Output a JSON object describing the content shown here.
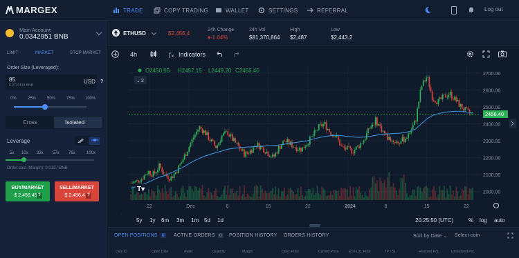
{
  "brand": "MARGEX",
  "nav": [
    {
      "label": "TRADE",
      "icon": "trade-icon",
      "active": true
    },
    {
      "label": "COPY TRADING",
      "icon": "copy-icon",
      "active": false
    },
    {
      "label": "WALLET",
      "icon": "wallet-icon",
      "active": false
    },
    {
      "label": "SETTINGS",
      "icon": "gear-icon",
      "active": false
    },
    {
      "label": "REFERRAL",
      "icon": "referral-icon",
      "active": false
    }
  ],
  "topright": {
    "logout": "Log out"
  },
  "account": {
    "label": "Main Account",
    "balance": "0.0342951 BNB"
  },
  "order_tabs": [
    "LIMIT",
    "MARKET",
    "STOP MARKET"
  ],
  "order_size": {
    "label": "Order Size (Leveraged):",
    "value": "85",
    "sub": "0.2733119 BNB",
    "unit": "USD"
  },
  "size_percents": [
    "0%",
    "25%",
    "50%",
    "75%",
    "100%"
  ],
  "size_slider_fraction": 0.43,
  "margin_modes": [
    "Cross",
    "Isolated"
  ],
  "leverage": {
    "label": "Leverage",
    "options": [
      "5x",
      "10x",
      "33x",
      "57x",
      "76x",
      "100x"
    ],
    "slider_fraction": 0.21
  },
  "order_cost": "Order cost (Margin): 0.0137 BNB",
  "buy": {
    "title": "BUY/MARKET",
    "price": "$ 2,456.45"
  },
  "sell": {
    "title": "SELL/MARKET",
    "price": "$ 2,456.4"
  },
  "ticker": {
    "symbol": "ETHUSD",
    "price": "$2,456.4",
    "change_label": "24h Change",
    "change_value": "-1.04%",
    "vol_label": "24h Vol",
    "vol_value": "$81,370,864",
    "high_label": "High",
    "high_value": "$2,487",
    "low_label": "Low",
    "low_value": "$2,443.2"
  },
  "toolbar": {
    "interval": "4h",
    "indicators": "Indicators"
  },
  "chart_data": {
    "type": "candlestick",
    "legend": {
      "o": "O2450.55",
      "h": "H2457.15",
      "l": "L2449.20",
      "c": "C2456.40",
      "count": "2"
    },
    "x_ticks": [
      "22",
      "Dec",
      "8",
      "15",
      "22",
      "2024",
      "8",
      "15",
      "22"
    ],
    "y_ticks": [
      "2700.00",
      "2600.00",
      "2500.00",
      "2400.00",
      "2300.00",
      "2200.00",
      "2100.00",
      "2000.00"
    ],
    "ylim": [
      1950,
      2740
    ],
    "last_price": "2456.40",
    "close_path": [
      2050,
      2060,
      2080,
      2120,
      2100,
      2150,
      2100,
      2080,
      2120,
      2180,
      2250,
      2320,
      2380,
      2350,
      2300,
      2260,
      2330,
      2350,
      2300,
      2260,
      2220,
      2240,
      2280,
      2260,
      2230,
      2200,
      2260,
      2300,
      2280,
      2260,
      2250,
      2290,
      2330,
      2380,
      2400,
      2350,
      2330,
      2260,
      2250,
      2240,
      2270,
      2310,
      2380,
      2420,
      2370,
      2320,
      2300,
      2290,
      2310,
      2350,
      2420,
      2620,
      2680,
      2550,
      2530,
      2560,
      2580,
      2540,
      2500,
      2470,
      2456
    ],
    "ma_path": [
      2020,
      2030,
      2040,
      2055,
      2070,
      2085,
      2095,
      2110,
      2125,
      2140,
      2160,
      2180,
      2195,
      2210,
      2220,
      2230,
      2240,
      2250,
      2255,
      2260,
      2262,
      2264,
      2266,
      2268,
      2270,
      2272,
      2275,
      2280,
      2285,
      2290,
      2295,
      2300,
      2310,
      2318,
      2325,
      2330,
      2332,
      2330,
      2326,
      2322,
      2320,
      2322,
      2326,
      2332,
      2338,
      2340,
      2342,
      2344,
      2348,
      2355,
      2370,
      2400,
      2430,
      2450,
      2460,
      2468,
      2472,
      2474,
      2474,
      2470,
      2468
    ]
  },
  "time_ranges": [
    "5y",
    "1y",
    "6m",
    "3m",
    "1m",
    "5d",
    "1d"
  ],
  "clock": "20:25:50 (UTC)",
  "scale_opts": [
    "%",
    "log",
    "auto"
  ],
  "bottom_tabs": {
    "open": "OPEN POSITIONS",
    "open_count": "0",
    "active": "ACTIVE ORDERS",
    "active_count": "0",
    "history": "POSITION HISTORY",
    "orders": "ORDERS HISTORY"
  },
  "sort": "Sort by Date",
  "select_coin": "Select coin",
  "columns": [
    "Deal ID",
    "Open Date",
    "Asset",
    "Quantity",
    "Margin",
    "Open Price",
    "Current Price",
    "EST Liq. Price",
    "TP / SL",
    "Realized PnL",
    "Unrealized PnL"
  ]
}
